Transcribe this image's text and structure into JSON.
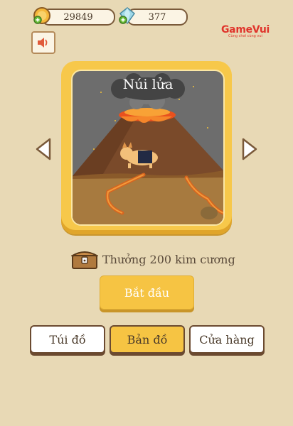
{
  "currency": {
    "gold": {
      "value": "29849",
      "icon": "gold-coin-plus-icon"
    },
    "diamond": {
      "value": "377",
      "icon": "diamond-plus-icon"
    }
  },
  "sound": {
    "icon": "speaker-icon"
  },
  "logo": {
    "text": "GameVui",
    "tagline": "Cùng chơi cùng vui"
  },
  "level": {
    "title": "Núi lửa"
  },
  "reward": {
    "text": "Thưởng 200 kim cương",
    "icon": "treasure-chest-icon"
  },
  "buttons": {
    "start": "Bắt đầu",
    "inventory": "Túi đồ",
    "map": "Bản đồ",
    "shop": "Cửa hàng"
  },
  "colors": {
    "background": "#e8d9b5",
    "frame": "#f7c84a",
    "button_yellow": "#f6c443",
    "logo_red": "#e0342b"
  }
}
